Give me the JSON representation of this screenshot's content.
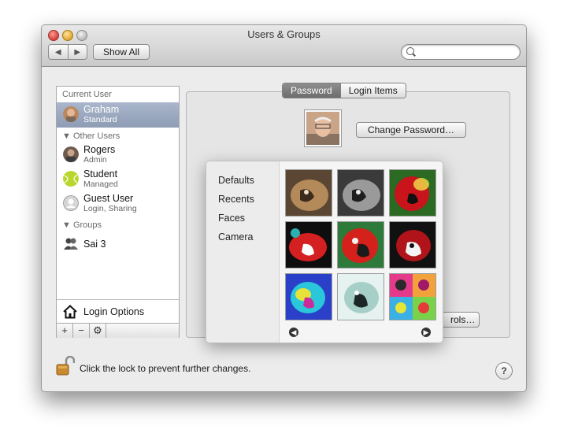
{
  "window": {
    "title": "Users & Groups"
  },
  "toolbar": {
    "back_label": "◀",
    "forward_label": "▶",
    "show_all_label": "Show All",
    "search_placeholder": ""
  },
  "sidebar": {
    "current_user_header": "Current User",
    "current_user": {
      "name": "Graham",
      "role": "Standard"
    },
    "other_users_header": "Other Users",
    "other_users": [
      {
        "name": "Rogers",
        "role": "Admin"
      },
      {
        "name": "Student",
        "role": "Managed"
      },
      {
        "name": "Guest User",
        "role": "Login, Sharing"
      }
    ],
    "groups_header": "Groups",
    "groups": [
      {
        "name": "Sai 3"
      }
    ],
    "login_options_label": "Login Options",
    "add_label": "+",
    "remove_label": "−",
    "actions_label": "⚙"
  },
  "tabs": [
    {
      "label": "Password"
    },
    {
      "label": "Login Items"
    }
  ],
  "main": {
    "change_password_label": "Change Password…",
    "partial_button_label": "rols…"
  },
  "picture_popover": {
    "menu": [
      "Defaults",
      "Recents",
      "Faces",
      "Camera"
    ],
    "effects": [
      "sepia",
      "grayscale",
      "glow",
      "comic",
      "original",
      "thermal",
      "x-ray",
      "colored-pencil",
      "pop-art"
    ]
  },
  "footer": {
    "lock_text": "Click the lock to prevent further changes.",
    "help_label": "?"
  },
  "colors": {
    "selection": "#98a6be",
    "window_bg": "#ececec"
  }
}
